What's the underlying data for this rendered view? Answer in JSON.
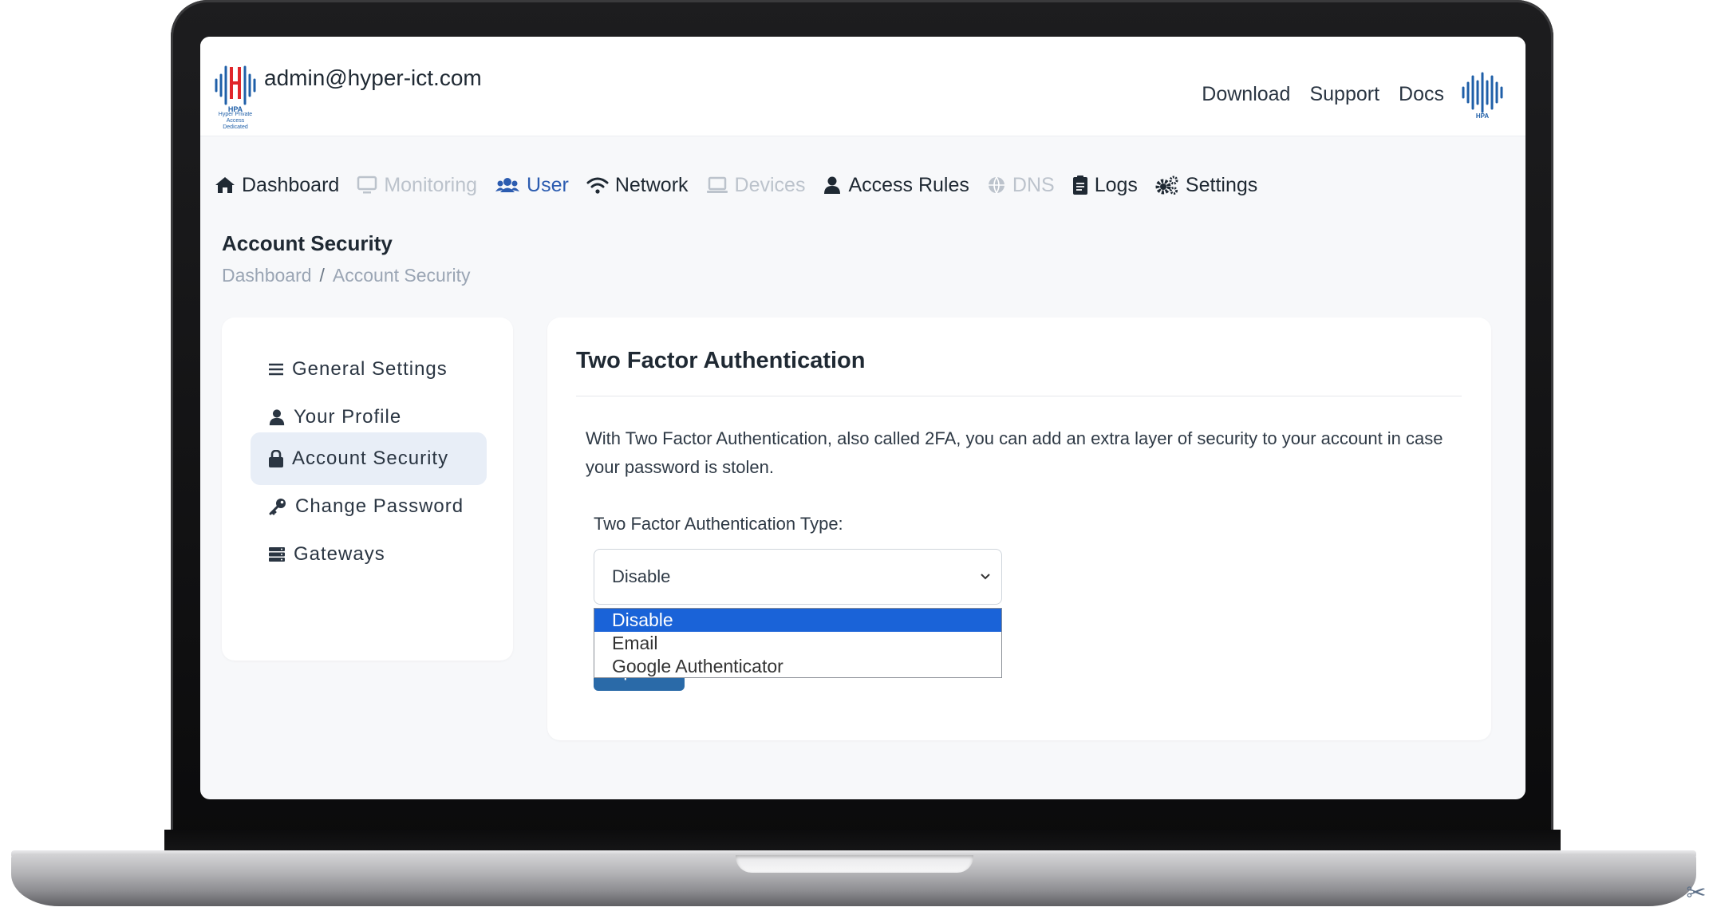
{
  "header": {
    "user_email": "admin@hyper-ict.com",
    "links": [
      "Download",
      "Support",
      "Docs"
    ],
    "brand_short": "HPA",
    "brand_sub": "Hyper Private Access",
    "brand_edition": "Dedicated"
  },
  "nav": {
    "items": [
      {
        "label": "Dashboard",
        "icon": "home-icon",
        "state": "normal"
      },
      {
        "label": "Monitoring",
        "icon": "monitor-icon",
        "state": "disabled"
      },
      {
        "label": "User",
        "icon": "users-icon",
        "state": "active"
      },
      {
        "label": "Network",
        "icon": "wifi-icon",
        "state": "normal"
      },
      {
        "label": "Devices",
        "icon": "laptop-icon",
        "state": "disabled"
      },
      {
        "label": "Access Rules",
        "icon": "user-icon",
        "state": "normal"
      },
      {
        "label": "DNS",
        "icon": "globe-icon",
        "state": "disabled"
      },
      {
        "label": "Logs",
        "icon": "clipboard-icon",
        "state": "normal"
      },
      {
        "label": "Settings",
        "icon": "cogs-icon",
        "state": "normal"
      }
    ]
  },
  "page": {
    "title": "Account Security",
    "breadcrumb": [
      "Dashboard",
      "Account Security"
    ],
    "breadcrumb_sep": "/"
  },
  "sidebar": {
    "items": [
      {
        "label": "General Settings",
        "icon": "list-icon"
      },
      {
        "label": "Your Profile",
        "icon": "user-icon"
      },
      {
        "label": "Account Security",
        "icon": "lock-icon",
        "active": true
      },
      {
        "label": "Change Password",
        "icon": "key-icon"
      },
      {
        "label": "Gateways",
        "icon": "server-icon"
      }
    ]
  },
  "card": {
    "title": "Two Factor Authentication",
    "description": "With Two Factor Authentication, also called 2FA, you can add an extra layer of security to your account in case your password is stolen.",
    "field_label": "Two Factor Authentication Type:",
    "select_value": "Disable",
    "options": [
      "Disable",
      "Email",
      "Google Authenticator"
    ],
    "highlighted_option": "Disable",
    "update_label": "Update"
  },
  "colors": {
    "accent": "#2c5cb0",
    "button": "#2a6aa8",
    "option_highlight": "#1a63d8",
    "disabled": "#bcc3cc"
  }
}
